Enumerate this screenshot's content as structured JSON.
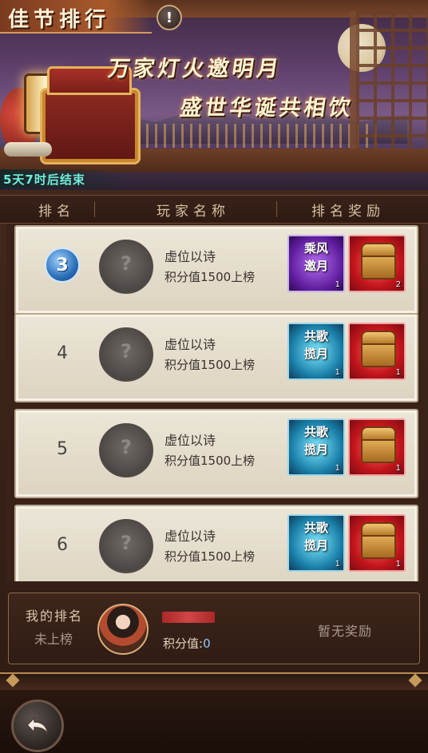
{
  "banner": {
    "title": "佳节排行",
    "info_icon": "exclamation-icon",
    "slogan_line1": "万家灯火邀明月",
    "slogan_line2": "盛世华诞共相饮",
    "countdown": "5天7时后结束"
  },
  "header": {
    "rank": "排名",
    "name": "玩家名称",
    "reward": "排名奖励"
  },
  "rows": [
    {
      "rank": "3",
      "name": "虚位以诗",
      "score": "积分值1500上榜",
      "reward1": {
        "text": "乘风邀月",
        "qty": "1",
        "color": "#7a2fc0"
      },
      "reward2": {
        "qty": "2",
        "color": "#c3151c"
      }
    },
    {
      "rank": "4",
      "name": "虚位以诗",
      "score": "积分值1500上榜",
      "reward1": {
        "text": "共歌揽月",
        "qty": "1",
        "color": "#1a7fa8"
      },
      "reward2": {
        "qty": "1",
        "color": "#c3151c"
      }
    },
    {
      "rank": "5",
      "name": "虚位以诗",
      "score": "积分值1500上榜",
      "reward1": {
        "text": "共歌揽月",
        "qty": "1",
        "color": "#1a7fa8"
      },
      "reward2": {
        "qty": "1",
        "color": "#c3151c"
      }
    },
    {
      "rank": "6",
      "name": "虚位以诗",
      "score": "积分值1500上榜",
      "reward1": {
        "text": "共歌揽月",
        "qty": "1",
        "color": "#1a7fa8"
      },
      "reward2": {
        "qty": "1",
        "color": "#c3151c"
      }
    }
  ],
  "placeholder_avatar_glyph": "?",
  "my_rank": {
    "label": "我的排名",
    "status": "未上榜",
    "score_label": "积分值:",
    "score_value": "0",
    "reward_text": "暂无奖励"
  },
  "back_icon": "back-arrow-icon"
}
